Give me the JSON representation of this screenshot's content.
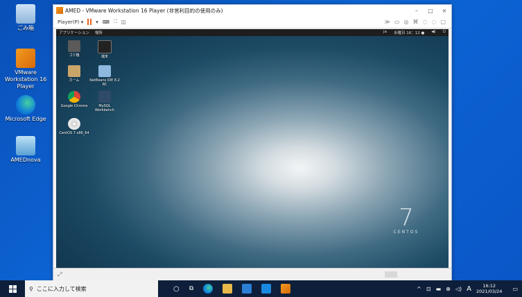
{
  "desktop": {
    "icons": [
      {
        "label": "ごみ箱"
      },
      {
        "label": "VMware Workstation 16 Player"
      },
      {
        "label": "Microsoft Edge"
      },
      {
        "label": "AMEDnova"
      }
    ]
  },
  "window": {
    "title": "AMED - VMware Workstation 16 Player (非営利目的の使用のみ)",
    "controls": [
      "–",
      "□",
      "×"
    ],
    "toolbar": {
      "player_label": "Player(P)"
    }
  },
  "guest": {
    "topbar": {
      "applications": "アプリケーション",
      "places": "場所",
      "lang": "ja",
      "clock": "水曜日 16：12 ●"
    },
    "icons": [
      {
        "label": "ゴミ箱"
      },
      {
        "label": "端末"
      },
      {
        "label": "ホーム"
      },
      {
        "label": "NetBeans IDE 8.2 RC"
      },
      {
        "label": "Google Chrome"
      },
      {
        "label": "MySQL Workbench"
      },
      {
        "label": "CentOS 7 x86_64"
      }
    ],
    "brand": {
      "number": "7",
      "word": "CENTOS"
    }
  },
  "taskbar": {
    "search_placeholder": "ここに入力して検索",
    "time": "16:12",
    "date": "2021/03/24",
    "ime": "A"
  },
  "colors": {
    "accent": "#0a56c7",
    "taskbar": "#0d1f3a",
    "pause": "#e8601c"
  }
}
